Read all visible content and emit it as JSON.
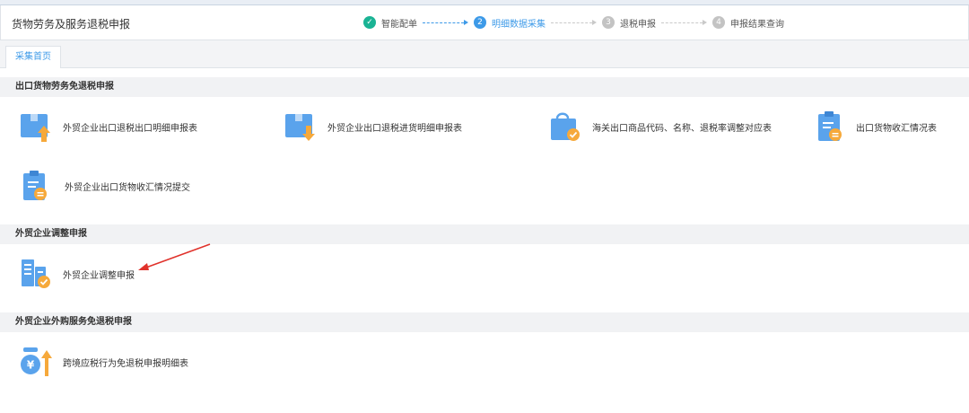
{
  "header": {
    "title": "货物劳务及服务退税申报",
    "steps": [
      {
        "number": "1",
        "label": "智能配单",
        "state": "done"
      },
      {
        "number": "2",
        "label": "明细数据采集",
        "state": "active"
      },
      {
        "number": "3",
        "label": "退税申报",
        "state": "todo"
      },
      {
        "number": "4",
        "label": "申报结果查询",
        "state": "todo"
      }
    ]
  },
  "tabs": [
    {
      "label": "采集首页"
    }
  ],
  "sections": [
    {
      "title": "出口货物劳务免退税申报",
      "items": [
        {
          "label": "外贸企业出口退税出口明细申报表",
          "icon": "box-upload-icon"
        },
        {
          "label": "外贸企业出口退税进货明细申报表",
          "icon": "box-download-icon"
        },
        {
          "label": "海关出口商品代码、名称、退税率调整对应表",
          "icon": "shopping-bag-check-icon"
        },
        {
          "label": "出口货物收汇情况表",
          "icon": "clipboard-yen-icon"
        },
        {
          "label": "外贸企业出口货物收汇情况提交",
          "icon": "clipboard-yen-icon"
        }
      ]
    },
    {
      "title": "外贸企业调整申报",
      "items": [
        {
          "label": "外贸企业调整申报",
          "icon": "building-check-icon"
        }
      ]
    },
    {
      "title": "外贸企业外购服务免退税申报",
      "items": [
        {
          "label": "跨境应税行为免退税申报明细表",
          "icon": "yen-coin-up-icon"
        }
      ]
    }
  ],
  "colors": {
    "icon_blue": "#5aa3ec",
    "icon_orange": "#f6a93b",
    "step_done": "#1ab394",
    "step_active": "#3d9ae8",
    "annotation_arrow": "#e0322b"
  }
}
